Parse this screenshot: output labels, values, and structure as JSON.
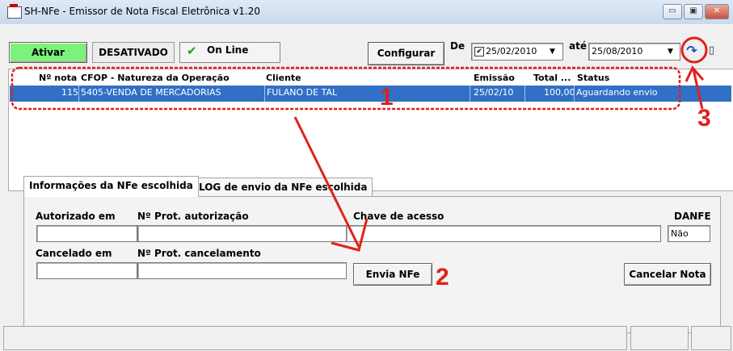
{
  "window": {
    "title": "SH-NFe - Emissor de Nota Fiscal Eletrônica v1.20",
    "minimize_glyph": "▭",
    "maximize_glyph": "▣",
    "close_glyph": "✕"
  },
  "toolbar": {
    "ativar_label": "Ativar",
    "desativado_label": "DESATIVADO",
    "online_label": "On Line",
    "configurar_label": "Configurar",
    "de_label": "De",
    "de_date": "25/02/2010",
    "ate_label": "até",
    "ate_date": "25/08/2010"
  },
  "grid": {
    "columns": [
      "Nº nota",
      "CFOP - Natureza da Operação",
      "Cliente",
      "Emissão",
      "Total ...",
      "Status"
    ],
    "rows": [
      {
        "num": "115",
        "cfop": "5405-VENDA DE MERCADORIAS",
        "cliente": "FULANO DE TAL",
        "emissao": "25/02/10",
        "total": "100,00",
        "status": "Aguardando envio"
      }
    ]
  },
  "tabs": [
    {
      "label": "Informações da NFe escolhida",
      "active": true
    },
    {
      "label": "LOG de envio da NFe escolhida",
      "active": false
    }
  ],
  "form": {
    "autorizado_label": "Autorizado em",
    "prot_autorizacao_label": "Nº Prot. autorização",
    "chave_label": "Chave de acesso",
    "danfe_label": "DANFE",
    "danfe_value": "Não",
    "cancelado_label": "Cancelado em",
    "prot_cancelamento_label": "Nº Prot. cancelamento",
    "envia_label": "Envia NFe",
    "cancelar_label": "Cancelar Nota"
  },
  "annotations": {
    "n1": "1",
    "n2": "2",
    "n3": "3"
  },
  "colors": {
    "accent": "#e0211c",
    "selection": "#3170c5",
    "ativar_bg": "#7cf27c"
  }
}
